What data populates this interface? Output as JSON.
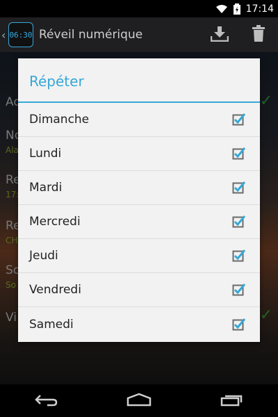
{
  "status_bar": {
    "time": "17:14"
  },
  "app_bar": {
    "title": "Réveil numérique",
    "logo_text": "06:30"
  },
  "background": {
    "rows": [
      {
        "label": "Ac",
        "sub": "",
        "checked": true
      },
      {
        "label": "No",
        "sub": "Ala",
        "checked": false
      },
      {
        "label": "Re",
        "sub": "17:",
        "checked": false
      },
      {
        "label": "Re",
        "sub": "CH",
        "checked": false
      },
      {
        "label": "So",
        "sub": "So",
        "checked": false
      },
      {
        "label": "Vi",
        "sub": "",
        "checked": true
      }
    ]
  },
  "dialog": {
    "title": "Répéter",
    "days": [
      {
        "label": "Dimanche",
        "checked": true
      },
      {
        "label": "Lundi",
        "checked": true
      },
      {
        "label": "Mardi",
        "checked": true
      },
      {
        "label": "Mercredi",
        "checked": true
      },
      {
        "label": "Jeudi",
        "checked": true
      },
      {
        "label": "Vendredi",
        "checked": true
      },
      {
        "label": "Samedi",
        "checked": true
      }
    ]
  },
  "colors": {
    "accent": "#35a8d6",
    "check_green": "#3db44a"
  }
}
